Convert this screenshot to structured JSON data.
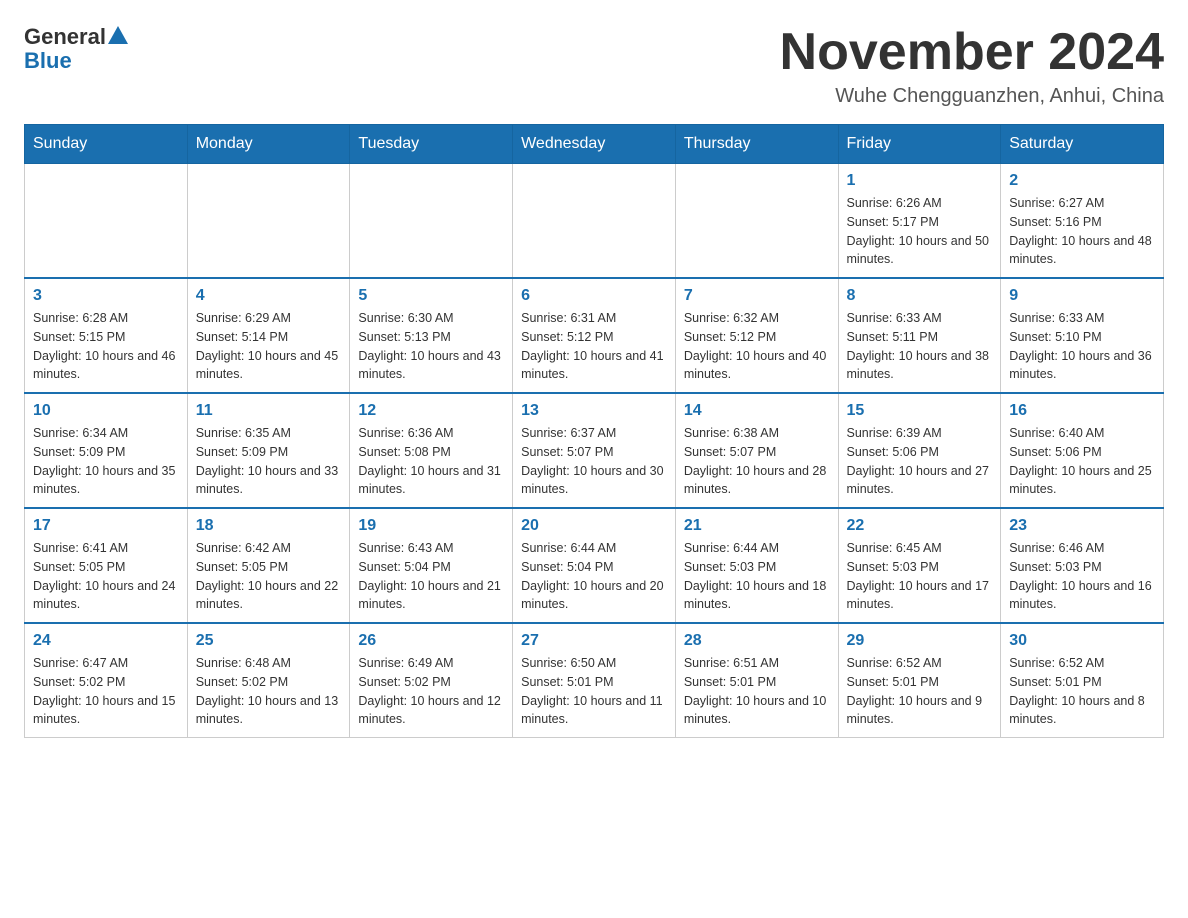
{
  "header": {
    "logo_general": "General",
    "logo_blue": "Blue",
    "month_title": "November 2024",
    "subtitle": "Wuhe Chengguanzhen, Anhui, China"
  },
  "weekdays": [
    "Sunday",
    "Monday",
    "Tuesday",
    "Wednesday",
    "Thursday",
    "Friday",
    "Saturday"
  ],
  "weeks": [
    [
      {
        "day": "",
        "info": ""
      },
      {
        "day": "",
        "info": ""
      },
      {
        "day": "",
        "info": ""
      },
      {
        "day": "",
        "info": ""
      },
      {
        "day": "",
        "info": ""
      },
      {
        "day": "1",
        "info": "Sunrise: 6:26 AM\nSunset: 5:17 PM\nDaylight: 10 hours and 50 minutes."
      },
      {
        "day": "2",
        "info": "Sunrise: 6:27 AM\nSunset: 5:16 PM\nDaylight: 10 hours and 48 minutes."
      }
    ],
    [
      {
        "day": "3",
        "info": "Sunrise: 6:28 AM\nSunset: 5:15 PM\nDaylight: 10 hours and 46 minutes."
      },
      {
        "day": "4",
        "info": "Sunrise: 6:29 AM\nSunset: 5:14 PM\nDaylight: 10 hours and 45 minutes."
      },
      {
        "day": "5",
        "info": "Sunrise: 6:30 AM\nSunset: 5:13 PM\nDaylight: 10 hours and 43 minutes."
      },
      {
        "day": "6",
        "info": "Sunrise: 6:31 AM\nSunset: 5:12 PM\nDaylight: 10 hours and 41 minutes."
      },
      {
        "day": "7",
        "info": "Sunrise: 6:32 AM\nSunset: 5:12 PM\nDaylight: 10 hours and 40 minutes."
      },
      {
        "day": "8",
        "info": "Sunrise: 6:33 AM\nSunset: 5:11 PM\nDaylight: 10 hours and 38 minutes."
      },
      {
        "day": "9",
        "info": "Sunrise: 6:33 AM\nSunset: 5:10 PM\nDaylight: 10 hours and 36 minutes."
      }
    ],
    [
      {
        "day": "10",
        "info": "Sunrise: 6:34 AM\nSunset: 5:09 PM\nDaylight: 10 hours and 35 minutes."
      },
      {
        "day": "11",
        "info": "Sunrise: 6:35 AM\nSunset: 5:09 PM\nDaylight: 10 hours and 33 minutes."
      },
      {
        "day": "12",
        "info": "Sunrise: 6:36 AM\nSunset: 5:08 PM\nDaylight: 10 hours and 31 minutes."
      },
      {
        "day": "13",
        "info": "Sunrise: 6:37 AM\nSunset: 5:07 PM\nDaylight: 10 hours and 30 minutes."
      },
      {
        "day": "14",
        "info": "Sunrise: 6:38 AM\nSunset: 5:07 PM\nDaylight: 10 hours and 28 minutes."
      },
      {
        "day": "15",
        "info": "Sunrise: 6:39 AM\nSunset: 5:06 PM\nDaylight: 10 hours and 27 minutes."
      },
      {
        "day": "16",
        "info": "Sunrise: 6:40 AM\nSunset: 5:06 PM\nDaylight: 10 hours and 25 minutes."
      }
    ],
    [
      {
        "day": "17",
        "info": "Sunrise: 6:41 AM\nSunset: 5:05 PM\nDaylight: 10 hours and 24 minutes."
      },
      {
        "day": "18",
        "info": "Sunrise: 6:42 AM\nSunset: 5:05 PM\nDaylight: 10 hours and 22 minutes."
      },
      {
        "day": "19",
        "info": "Sunrise: 6:43 AM\nSunset: 5:04 PM\nDaylight: 10 hours and 21 minutes."
      },
      {
        "day": "20",
        "info": "Sunrise: 6:44 AM\nSunset: 5:04 PM\nDaylight: 10 hours and 20 minutes."
      },
      {
        "day": "21",
        "info": "Sunrise: 6:44 AM\nSunset: 5:03 PM\nDaylight: 10 hours and 18 minutes."
      },
      {
        "day": "22",
        "info": "Sunrise: 6:45 AM\nSunset: 5:03 PM\nDaylight: 10 hours and 17 minutes."
      },
      {
        "day": "23",
        "info": "Sunrise: 6:46 AM\nSunset: 5:03 PM\nDaylight: 10 hours and 16 minutes."
      }
    ],
    [
      {
        "day": "24",
        "info": "Sunrise: 6:47 AM\nSunset: 5:02 PM\nDaylight: 10 hours and 15 minutes."
      },
      {
        "day": "25",
        "info": "Sunrise: 6:48 AM\nSunset: 5:02 PM\nDaylight: 10 hours and 13 minutes."
      },
      {
        "day": "26",
        "info": "Sunrise: 6:49 AM\nSunset: 5:02 PM\nDaylight: 10 hours and 12 minutes."
      },
      {
        "day": "27",
        "info": "Sunrise: 6:50 AM\nSunset: 5:01 PM\nDaylight: 10 hours and 11 minutes."
      },
      {
        "day": "28",
        "info": "Sunrise: 6:51 AM\nSunset: 5:01 PM\nDaylight: 10 hours and 10 minutes."
      },
      {
        "day": "29",
        "info": "Sunrise: 6:52 AM\nSunset: 5:01 PM\nDaylight: 10 hours and 9 minutes."
      },
      {
        "day": "30",
        "info": "Sunrise: 6:52 AM\nSunset: 5:01 PM\nDaylight: 10 hours and 8 minutes."
      }
    ]
  ]
}
